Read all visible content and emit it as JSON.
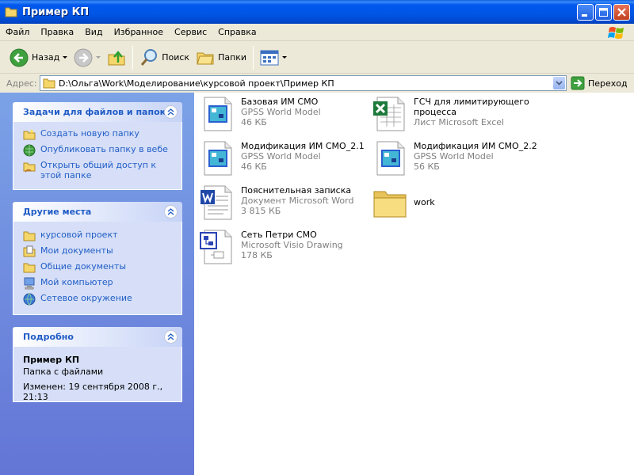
{
  "window": {
    "title": "Пример КП"
  },
  "menu": [
    "Файл",
    "Правка",
    "Вид",
    "Избранное",
    "Сервис",
    "Справка"
  ],
  "toolbar": {
    "back": "Назад",
    "search": "Поиск",
    "folders": "Папки"
  },
  "address": {
    "label": "Адрес:",
    "path": "D:\\Ольга\\Work\\Моделирование\\курсовой проект\\Пример КП",
    "go": "Переход"
  },
  "tasks_panel": {
    "title": "Задачи для файлов и папок",
    "items": [
      {
        "label": "Создать новую папку",
        "icon": "new-folder-icon"
      },
      {
        "label": "Опубликовать папку в вебе",
        "icon": "publish-web-icon"
      },
      {
        "label": "Открыть общий доступ к этой папке",
        "icon": "share-folder-icon"
      }
    ]
  },
  "places_panel": {
    "title": "Другие места",
    "items": [
      {
        "label": "курсовой проект",
        "icon": "folder-icon"
      },
      {
        "label": "Мои документы",
        "icon": "my-documents-icon"
      },
      {
        "label": "Общие документы",
        "icon": "folder-icon"
      },
      {
        "label": "Мой компьютер",
        "icon": "computer-icon"
      },
      {
        "label": "Сетевое окружение",
        "icon": "network-icon"
      }
    ]
  },
  "details_panel": {
    "title": "Подробно",
    "name": "Пример КП",
    "type": "Папка с файлами",
    "modified": "Изменен: 19 сентября 2008 г., 21:13"
  },
  "files": [
    {
      "name": "Базовая ИМ СМО",
      "type": "GPSS World Model",
      "size": "46 КБ",
      "icon": "gpss-file-icon"
    },
    {
      "name": "ГСЧ для лимитирующего процесса",
      "type": "Лист Microsoft Excel",
      "size": "",
      "icon": "excel-file-icon"
    },
    {
      "name": "Модификация ИМ СМО_2.1",
      "type": "GPSS World Model",
      "size": "46 КБ",
      "icon": "gpss-file-icon"
    },
    {
      "name": "Модификация ИМ СМО_2.2",
      "type": "GPSS World Model",
      "size": "56 КБ",
      "icon": "gpss-file-icon"
    },
    {
      "name": "Пояснительная записка",
      "type": "Документ Microsoft Word",
      "size": "3 815 КБ",
      "icon": "word-file-icon"
    },
    {
      "name": "work",
      "type": "",
      "size": "",
      "icon": "folder-icon"
    },
    {
      "name": "Сеть Петри СМО",
      "type": "Microsoft Visio Drawing",
      "size": "178 КБ",
      "icon": "visio-file-icon"
    }
  ]
}
